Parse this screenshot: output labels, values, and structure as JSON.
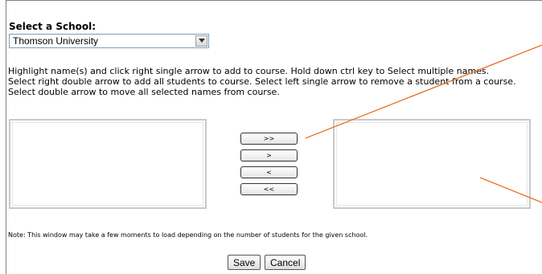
{
  "school": {
    "label": "Select a School:",
    "selected": "Thomson University"
  },
  "instructions": "Highlight name(s) and click right single arrow to add to course. Hold down ctrl key to Select multiple names. Select right double arrow to add all students to course. Select left single arrow to remove a student from a course. Select double arrow to move all selected names from course.",
  "transfer_buttons": {
    "add_all": ">>",
    "add": ">",
    "remove": "<",
    "remove_all": "<<"
  },
  "note": "Note: This window may take a few moments to load depending on the number of students for the given school.",
  "footer": {
    "save": "Save",
    "cancel": "Cancel"
  },
  "annotation_color": "#e8712a"
}
